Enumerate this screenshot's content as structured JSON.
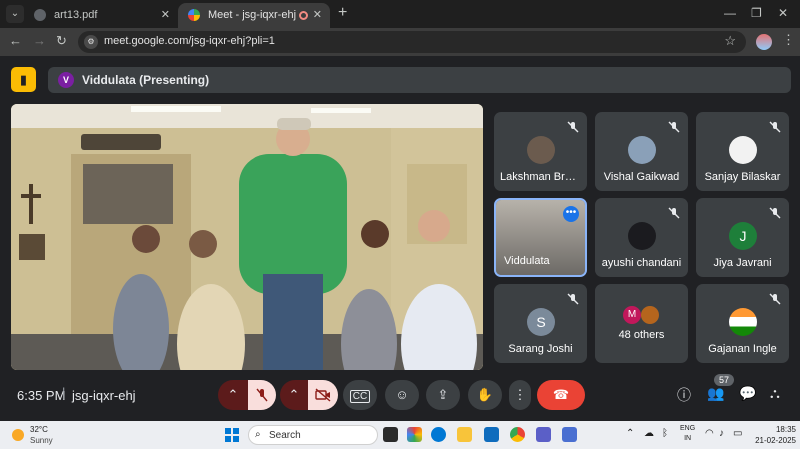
{
  "browser": {
    "tabs": [
      {
        "label": "art13.pdf"
      },
      {
        "label": "Meet - jsg-iqxr-ehj"
      }
    ],
    "url": "meet.google.com/jsg-iqxr-ehj?pli=1"
  },
  "meet": {
    "presenter_initial": "V",
    "presenter_label": "Viddulata (Presenting)",
    "participants": [
      {
        "name": "Lakshman Brah…",
        "avatar": "photo"
      },
      {
        "name": "Vishal Gaikwad",
        "avatar": "photo"
      },
      {
        "name": "Sanjay Bilaskar",
        "avatar": "photo"
      },
      {
        "name": "Viddulata",
        "avatar": "video"
      },
      {
        "name": "ayushi chandani",
        "avatar": "photo"
      },
      {
        "name": "Jiya Javrani",
        "initial": "J",
        "color": "#1e7f3a"
      },
      {
        "name": "Sarang Joshi",
        "initial": "S",
        "color": "#7b8a9a"
      },
      {
        "name": "48 others",
        "initial": "M",
        "color": "#c2185b"
      },
      {
        "name": "Gajanan Ingle",
        "avatar": "flag"
      }
    ],
    "time": "6:35 PM",
    "meeting_code": "jsg-iqxr-ehj",
    "people_count": "57"
  },
  "taskbar": {
    "temperature": "32°C",
    "weather": "Sunny",
    "search_placeholder": "Search",
    "lang_top": "ENG",
    "lang_bottom": "IN",
    "time": "18:35",
    "date": "21-02-2025"
  },
  "colors": {
    "meet_bg": "#202124",
    "tile_bg": "#3c4043",
    "hangup": "#ea4335",
    "active_border": "#8ab4f8",
    "meet_logo": "#fbbc04"
  }
}
